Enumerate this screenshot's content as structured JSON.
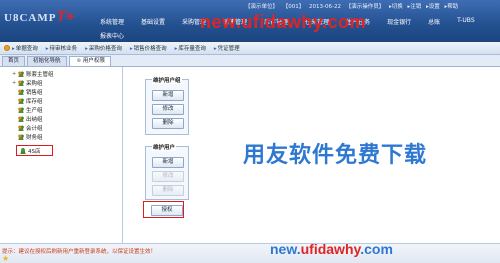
{
  "header": {
    "logo_word": "U8CAMP",
    "logo_t": "T+",
    "info": [
      "【演示单位】",
      "【001】",
      "2013-06-22",
      "【演示操作员】",
      "▸切换",
      "▸注销",
      "▸设置",
      "▸帮助"
    ],
    "menu": [
      "系统管理",
      "基础设置",
      "采购管理",
      "销售管理",
      "库存管理",
      "往来管理",
      "生产任务",
      "现金银行",
      "总账",
      "T-UBS"
    ],
    "report_center": "报表中心",
    "watermark": "new.ufidawhy.com"
  },
  "quickbar": {
    "items": [
      "单据查询",
      "待审核业务",
      "采购价格查询",
      "销售价格查询",
      "库存量查询",
      "凭证管理"
    ]
  },
  "tabs": [
    {
      "label": "首页",
      "active": false
    },
    {
      "label": "初始化导航",
      "active": false
    },
    {
      "label": "用户权限",
      "active": true
    }
  ],
  "tree": {
    "nodes": [
      {
        "label": "账套主管组",
        "icon": "group",
        "expand": "+"
      },
      {
        "label": "采购组",
        "icon": "group",
        "expand": "+"
      },
      {
        "label": "销售组",
        "icon": "group",
        "expand": ""
      },
      {
        "label": "库存组",
        "icon": "group",
        "expand": ""
      },
      {
        "label": "生产组",
        "icon": "group",
        "expand": ""
      },
      {
        "label": "出纳组",
        "icon": "group",
        "expand": ""
      },
      {
        "label": "会计组",
        "icon": "group",
        "expand": ""
      },
      {
        "label": "财务组",
        "icon": "group",
        "expand": ""
      },
      {
        "label": "4S店",
        "icon": "person",
        "expand": ""
      }
    ]
  },
  "user_group_panel": {
    "title": "维护用户组",
    "buttons": [
      {
        "label": "新增",
        "enabled": true
      },
      {
        "label": "修改",
        "enabled": true
      },
      {
        "label": "删除",
        "enabled": true
      }
    ]
  },
  "user_panel": {
    "title": "维护用户",
    "buttons": [
      {
        "label": "新增",
        "enabled": true
      },
      {
        "label": "修改",
        "enabled": false
      },
      {
        "label": "删除",
        "enabled": false
      }
    ]
  },
  "authorize_button": "授权",
  "watermark_mid": "用友软件免费下载",
  "watermark_bottom": {
    "pre": "new.",
    "main": "ufidawhy",
    "post": ".com"
  },
  "status": {
    "message": "提示：建议在授权后刷新用户重新登录系统，以保证设置生效！"
  }
}
